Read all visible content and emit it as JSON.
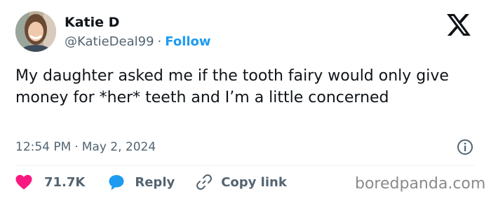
{
  "user": {
    "display_name": "Katie D",
    "handle": "@KatieDeal99",
    "separator": "·",
    "follow_label": "Follow"
  },
  "tweet": {
    "text": "My daughter asked me if the tooth fairy would only give money for *her* teeth and I’m a little concerned",
    "time": "12:54 PM",
    "date": "May 2, 2024",
    "separator": "·"
  },
  "actions": {
    "like_count": "71.7K",
    "reply_label": "Reply",
    "copy_label": "Copy link"
  },
  "watermark": "boredpanda.com",
  "icons": {
    "logo": "x-logo-icon",
    "info": "info-icon",
    "like": "heart-icon",
    "reply": "speech-bubble-icon",
    "copy": "link-icon"
  },
  "colors": {
    "text": "#0f1419",
    "muted": "#536471",
    "accent": "#1d9bf0",
    "heart": "#f91880",
    "divider": "#eff3f4"
  }
}
